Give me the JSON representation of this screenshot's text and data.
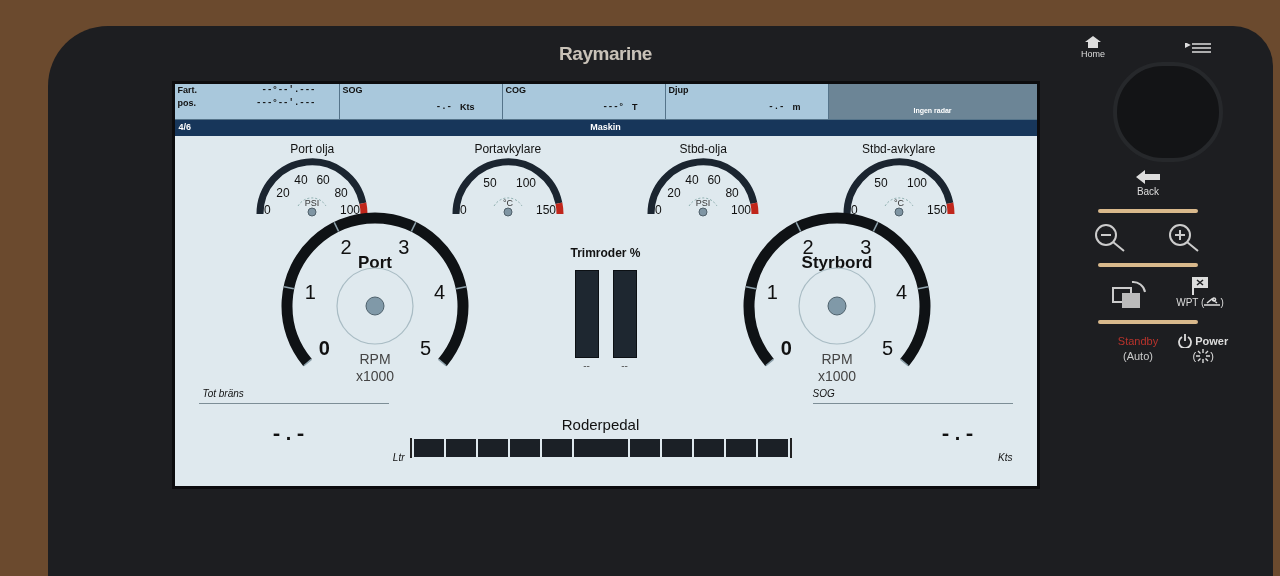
{
  "device": {
    "logo": "Raymarine"
  },
  "data_bar": [
    {
      "kind": "position",
      "labels": [
        "Fart.",
        "pos."
      ],
      "values": [
        "--°--'.---",
        "---°--'.---"
      ]
    },
    {
      "kind": "value",
      "label": "SOG",
      "value": "-.-",
      "unit": "Kts"
    },
    {
      "kind": "value",
      "label": "COG",
      "value": "---°",
      "unit": "T"
    },
    {
      "kind": "value",
      "label": "Djup",
      "value": "-.-",
      "unit": "m"
    },
    {
      "kind": "radar",
      "label": "Ingen radar"
    }
  ],
  "page_bar": {
    "page": "4/6",
    "title": "Maskin"
  },
  "small_gauges": [
    {
      "title": "Port olja",
      "ticks": [
        "0",
        "20",
        "40",
        "60",
        "80",
        "100"
      ],
      "unit": "PSI"
    },
    {
      "title": "Portavkylare",
      "ticks": [
        "0",
        "50",
        "100",
        "150"
      ],
      "unit": "°C"
    },
    {
      "title": "Stbd-olja",
      "ticks": [
        "0",
        "20",
        "40",
        "60",
        "80",
        "100"
      ],
      "unit": "PSI"
    },
    {
      "title": "Stbd-avkylare",
      "ticks": [
        "0",
        "50",
        "100",
        "150"
      ],
      "unit": "°C"
    }
  ],
  "rpm_gauges": [
    {
      "name": "Port",
      "ticks": [
        "0",
        "1",
        "2",
        "3",
        "4",
        "5"
      ],
      "unit": "RPM",
      "scale": "x1000"
    },
    {
      "name": "Styrbord",
      "ticks": [
        "0",
        "1",
        "2",
        "3",
        "4",
        "5"
      ],
      "unit": "RPM",
      "scale": "x1000"
    }
  ],
  "trim": {
    "title": "Trimroder %",
    "readings": [
      "--",
      "--"
    ]
  },
  "fuel": {
    "label": "Tot bräns",
    "value": "-.-",
    "unit": "Ltr"
  },
  "rudder": {
    "title": "Roderpedal"
  },
  "sog": {
    "label": "SOG",
    "value": "-.-",
    "unit": "Kts"
  },
  "keypad": {
    "home": "Home",
    "back": "Back",
    "wpt_before": "WPT (",
    "wpt_after": ")",
    "standby": "Standby",
    "standby_mode": "(Auto)",
    "power": "Power",
    "power_before": "(",
    "power_after": ")"
  }
}
